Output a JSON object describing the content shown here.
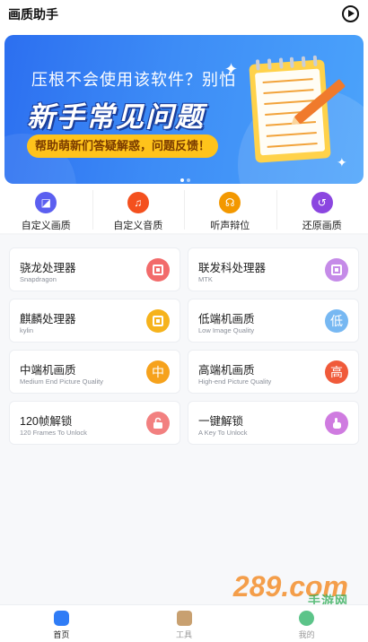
{
  "header": {
    "title": "画质助手",
    "play_icon": "play-circle-icon"
  },
  "banner": {
    "line1": "压根不会使用该软件？别怕",
    "line2": "新手常见问题",
    "pill": "帮助萌新们答疑解惑，问题反馈！"
  },
  "shortcuts": [
    {
      "label": "自定义画质",
      "icon": "custom-quality-icon",
      "color": "#5b5ff0"
    },
    {
      "label": "自定义音质",
      "icon": "music-note-icon",
      "color": "#f4501e"
    },
    {
      "label": "听声辩位",
      "icon": "headphones-icon",
      "color": "#f39800"
    },
    {
      "label": "还原画质",
      "icon": "restore-icon",
      "color": "#8b46e0"
    }
  ],
  "cards": [
    {
      "title": "骁龙处理器",
      "subtitle": "Snapdragon",
      "badge": "chip",
      "color": "#f26b6b"
    },
    {
      "title": "联发科处理器",
      "subtitle": "MTK",
      "badge": "chip",
      "color": "#c58be8"
    },
    {
      "title": "麒麟处理器",
      "subtitle": "kylin",
      "badge": "chip",
      "color": "#f6b31c"
    },
    {
      "title": "低端机画质",
      "subtitle": "Low Image Quality",
      "badge": "低",
      "color": "#77b8f2"
    },
    {
      "title": "中端机画质",
      "subtitle": "Medium End Picture Quality",
      "badge": "中",
      "color": "#f6a21c"
    },
    {
      "title": "高端机画质",
      "subtitle": "High-end Picture Quality",
      "badge": "高",
      "color": "#f05a3a"
    },
    {
      "title": "120帧解锁",
      "subtitle": "120 Frames To Unlock",
      "badge": "unlock",
      "color": "#f28080"
    },
    {
      "title": "一键解锁",
      "subtitle": "A Key To Unlock",
      "badge": "tap",
      "color": "#cf7be0"
    }
  ],
  "bottom_nav": [
    {
      "label": "首页",
      "icon": "gamepad-icon",
      "color": "#2f7cf6",
      "active": true
    },
    {
      "label": "工具",
      "icon": "box-icon",
      "color": "#c8a070",
      "active": false
    },
    {
      "label": "我的",
      "icon": "user-icon",
      "color": "#5cc489",
      "active": false
    }
  ],
  "watermark": {
    "brand": "289.com",
    "sub": "手游网"
  }
}
